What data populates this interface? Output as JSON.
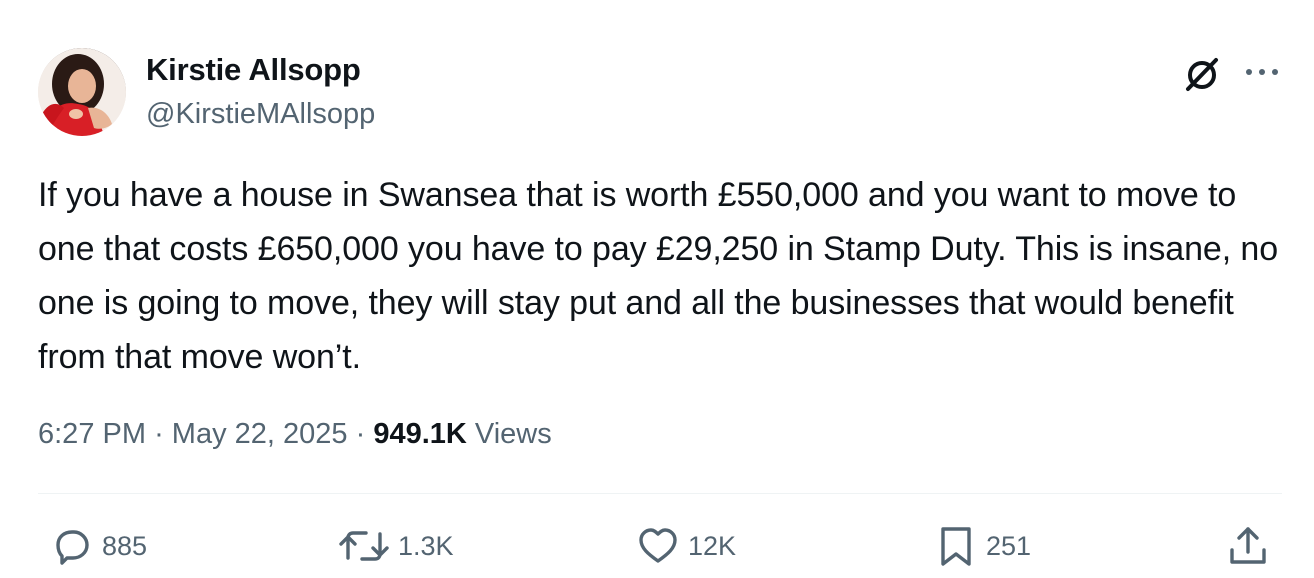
{
  "author": {
    "display_name": "Kirstie Allsopp",
    "handle": "@KirstieMAllsopp",
    "avatar_icon": "profile-photo"
  },
  "tweet": {
    "text": "If you have a house in Swansea that is worth £550,000 and you want to move to one that costs £650,000 you have to pay £29,250 in Stamp Duty. This is insane, no one is going to move, they will stay put and all the businesses that would benefit from that move won’t.",
    "time": "6:27 PM",
    "separator": "·",
    "date": "May 22, 2025",
    "views_count": "949.1K",
    "views_label": "Views"
  },
  "actions": {
    "replies": "885",
    "reposts": "1.3K",
    "likes": "12K",
    "bookmarks": "251"
  },
  "icons": {
    "header": [
      "grok-icon",
      "more-icon"
    ],
    "actions": [
      "reply-icon",
      "repost-icon",
      "like-icon",
      "bookmark-icon",
      "share-icon"
    ]
  },
  "colors": {
    "text_primary": "#0f1419",
    "text_secondary": "#536471",
    "divider": "#eff3f4",
    "avatar_accent": "#d81f26"
  }
}
